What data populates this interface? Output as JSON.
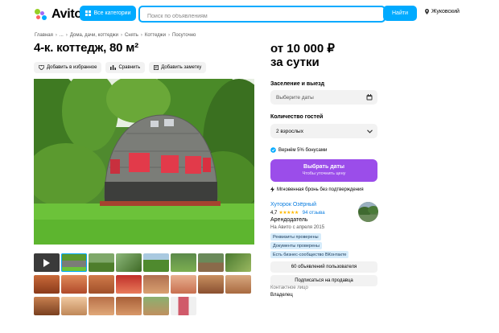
{
  "header": {
    "logo_text": "Avito",
    "categories_label": "Все категории",
    "search_placeholder": "Поиск по объявлениям",
    "search_button": "Найти",
    "location": "Жуковский"
  },
  "breadcrumbs": [
    "Главная",
    "...",
    "Дома, дачи, коттеджи",
    "Снять",
    "Коттеджи",
    "Посуточно"
  ],
  "listing": {
    "title": "4-к. коттедж, 80 м²",
    "actions": {
      "favorite": "Добавить в избранное",
      "compare": "Сравнить",
      "note": "Добавить заметку"
    }
  },
  "gallery": {
    "selected_index": 1,
    "thumb_count": 24
  },
  "booking": {
    "price_line1": "от 10 000 ₽",
    "price_line2": "за сутки",
    "dates_label": "Заселение и выезд",
    "dates_placeholder": "Выберите даты",
    "guests_label": "Количество гостей",
    "guests_value": "2 взрослых",
    "bonus_text": "Вернём 5% бонусами",
    "book_button": "Выбрать даты",
    "book_hint": "Чтобы уточнить цену",
    "instant_text": "Мгновенная бронь без подтверждения"
  },
  "seller": {
    "name": "Хуторок Озёрный",
    "rating": "4,7",
    "stars": "★★★★★",
    "reviews": "94 отзыва",
    "role": "Арендодатель",
    "since": "На Авито с апреля 2015",
    "badges": [
      "Реквизиты проверены",
      "Документы проверены",
      "Есть бизнес-сообщество ВКонтакте"
    ],
    "ads_button": "60 объявлений пользователя",
    "subscribe_button": "Подписаться на продавца",
    "contact_label": "Контактное лицо",
    "contact_value": "Владелец"
  },
  "colors": {
    "accent": "#00aaff",
    "book": "#9b4dea",
    "link": "#0a7de0",
    "star": "#ffb800"
  }
}
